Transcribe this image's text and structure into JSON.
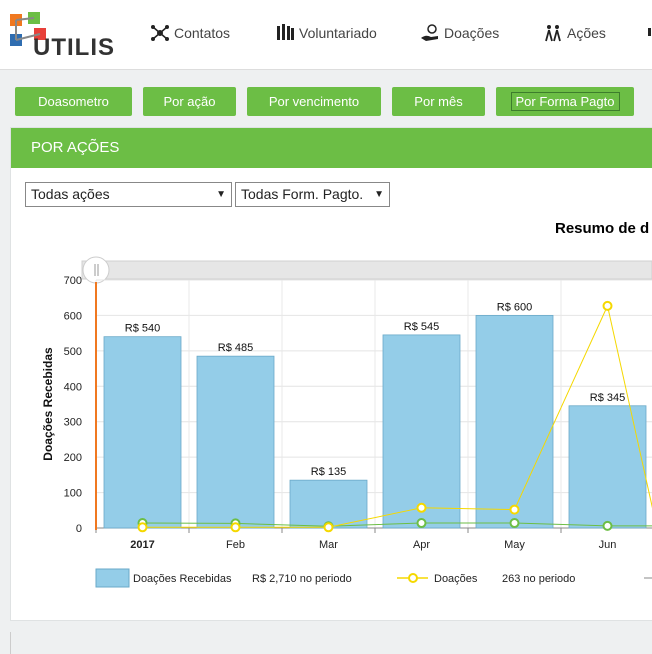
{
  "app": {
    "logo_text": "UTILIS"
  },
  "nav": [
    {
      "label": "Contatos",
      "icon": "network-icon"
    },
    {
      "label": "Voluntariado",
      "icon": "volunteers-icon"
    },
    {
      "label": "Doações",
      "icon": "donation-hand-icon"
    },
    {
      "label": "Ações",
      "icon": "actions-icon"
    }
  ],
  "report_buttons": [
    "Doasometro",
    "Por ação",
    "Por vencimento",
    "Por mês",
    "Por Forma Pagto"
  ],
  "active_report": "Por Forma Pagto",
  "panel": {
    "title": "POR AÇÕES"
  },
  "filters": {
    "action": "Todas ações",
    "payment": "Todas Form. Pagto."
  },
  "colors": {
    "green": "#6cbe45",
    "bar": "#94cde8",
    "line": "#f5d800",
    "green_line": "#6cbe45",
    "cursor": "#f07820"
  },
  "chart_data": {
    "type": "bar",
    "title": "Resumo de d",
    "ylabel": "Doações Recebidas",
    "ylim": [
      0,
      700
    ],
    "yticks": [
      0,
      100,
      200,
      300,
      400,
      500,
      600,
      700
    ],
    "categories": [
      "2017",
      "Feb",
      "Mar",
      "Apr",
      "May",
      "Jun"
    ],
    "series": [
      {
        "name": "Doações Recebidas",
        "type": "bar",
        "values": [
          540,
          485,
          135,
          545,
          600,
          345
        ],
        "labels": [
          "R$ 540",
          "R$ 485",
          "R$ 135",
          "R$ 545",
          "R$ 600",
          "R$ 345"
        ]
      },
      {
        "name": "Doações",
        "type": "line",
        "values": [
          2,
          2,
          2,
          57,
          52,
          627
        ]
      },
      {
        "name": "",
        "type": "line",
        "values": [
          14,
          13,
          5,
          14,
          14,
          6
        ]
      }
    ],
    "legend": [
      {
        "name": "Doações Recebidas",
        "summary": "R$ 2,710 no periodo"
      },
      {
        "name": "Doações",
        "summary": "263 no periodo"
      }
    ]
  }
}
